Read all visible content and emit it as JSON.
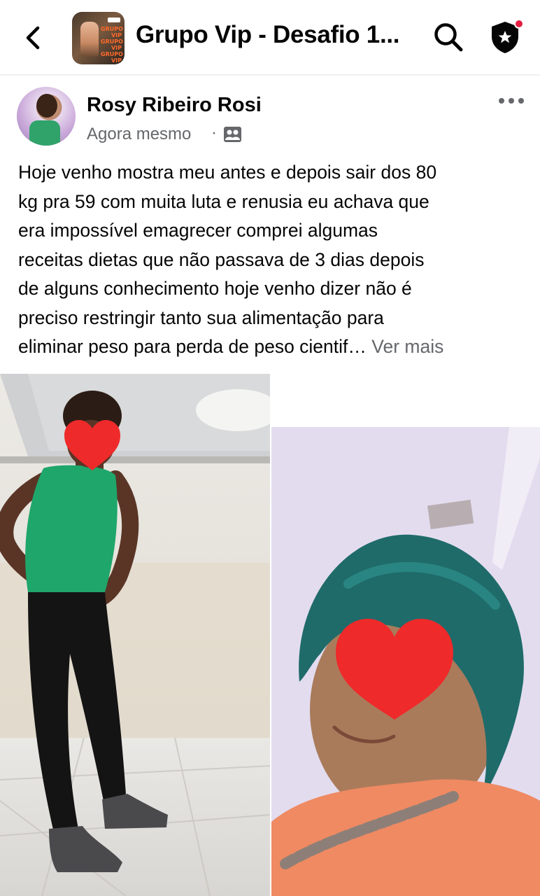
{
  "header": {
    "title": "Grupo Vip - Desafio 1...",
    "group_thumbnail_text": "GRUPO VIP GRUPO VIP GRUPO VIP"
  },
  "post": {
    "author": "Rosy Ribeiro Rosi",
    "time": "Agora mesmo",
    "separator": "·",
    "audience_icon": "group-members-icon",
    "text_lines": [
      "Hoje venho mostra meu antes e  depois sair dos 80",
      "kg pra 59 com muita luta e renusia eu achava que",
      "era impossível emagrecer comprei algumas",
      "receitas dietas que não passava de 3 dias depois",
      "de alguns conhecimento hoje venho dizer não é",
      "preciso restringir tanto sua alimentação para",
      "eliminar peso para perda de peso cientif…"
    ],
    "see_more": "Ver mais"
  },
  "icons": {
    "back": "chevron-left-icon",
    "search": "search-icon",
    "admin": "admin-shield-star-icon",
    "more": "more-horizontal-icon"
  },
  "colors": {
    "text": "#050505",
    "secondary_text": "#65676b",
    "notification_dot": "#e41e3f",
    "heart": "#ee2a2a"
  }
}
